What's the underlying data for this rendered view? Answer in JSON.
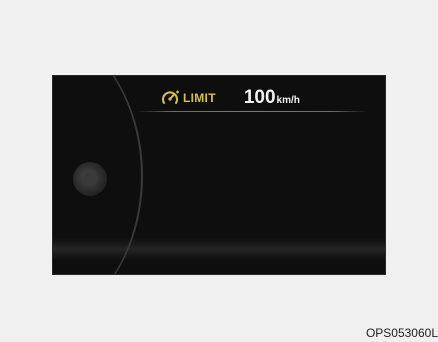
{
  "display": {
    "limit_icon": "speed-limiter-gauge-icon",
    "limit_label": "LIMIT",
    "speed_value": "100",
    "speed_unit": "km/h",
    "limit_color": "#d4c24a",
    "screen_color": "#0e0e0e"
  },
  "caption": {
    "code": "OPS053060L"
  }
}
